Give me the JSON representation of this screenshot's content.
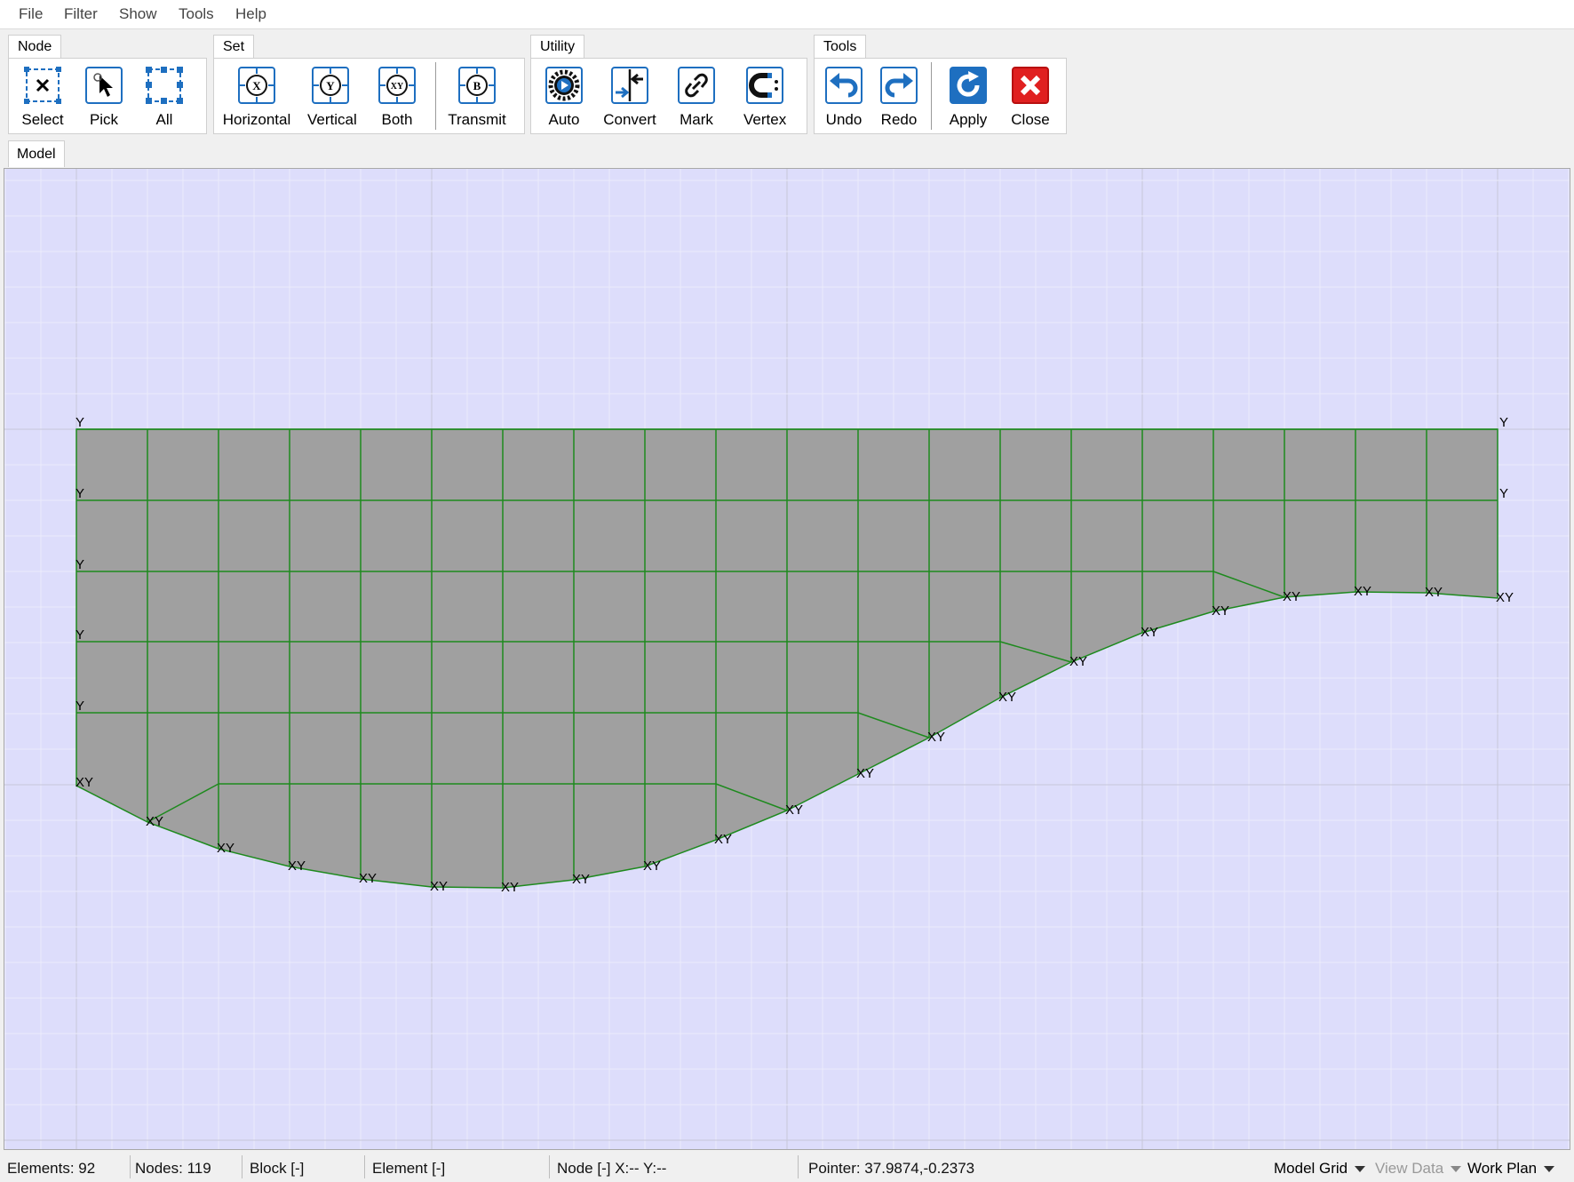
{
  "menu": [
    "File",
    "Filter",
    "Show",
    "Tools",
    "Help"
  ],
  "groups": {
    "node": "Node",
    "set": "Set",
    "utility": "Utility",
    "tools": "Tools"
  },
  "buttons": {
    "select": "Select",
    "pick": "Pick",
    "all": "All",
    "horizontal": "Horizontal",
    "vertical": "Vertical",
    "both": "Both",
    "transmit": "Transmit",
    "auto": "Auto",
    "convert": "Convert",
    "mark": "Mark",
    "vertex": "Vertex",
    "undo": "Undo",
    "redo": "Redo",
    "apply": "Apply",
    "close": "Close"
  },
  "icon_glyphs": {
    "x": "X",
    "y": "Y",
    "xy": "XY",
    "b": "B"
  },
  "model_tab": "Model",
  "fixity_labels": {
    "y": "Y",
    "xy": "XY"
  },
  "status": {
    "elements": "Elements: 92",
    "nodes": "Nodes: 119",
    "block": "Block [-]",
    "element": "Element [-]",
    "node": "Node [-]  X:-- Y:--",
    "pointer": "Pointer: 37.9874,-0.2373",
    "model_grid": "Model Grid",
    "view_data": "View Data",
    "work_plan": "Work Plan"
  },
  "colors": {
    "canvas_bg": "#ddddfb",
    "mesh_fill": "#a0a0a0",
    "mesh_line": "#1e8a1e",
    "icon_blue": "#1e6fc0",
    "close_red": "#e02020"
  }
}
